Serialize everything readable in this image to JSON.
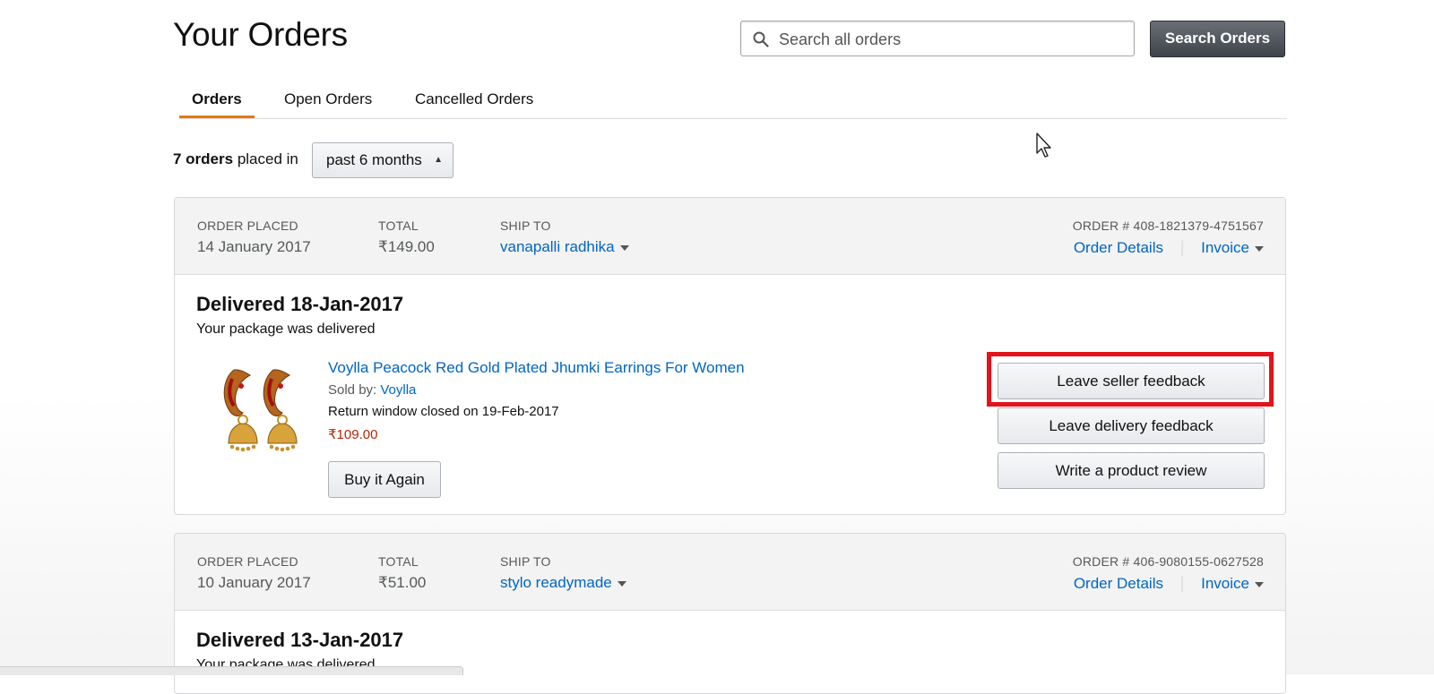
{
  "page": {
    "title": "Your Orders"
  },
  "search": {
    "placeholder": "Search all orders",
    "value": "",
    "button_label": "Search Orders"
  },
  "tabs": [
    {
      "label": "Orders",
      "active": true
    },
    {
      "label": "Open Orders",
      "active": false
    },
    {
      "label": "Cancelled Orders",
      "active": false
    }
  ],
  "filter": {
    "count_bold": "7 orders",
    "count_rest": "placed in",
    "period": "past 6 months"
  },
  "colors": {
    "accent_tab": "#e47911",
    "link": "#0066c0",
    "price": "#b12704",
    "highlight": "#e3131b"
  },
  "orders": [
    {
      "placed_label": "ORDER PLACED",
      "placed_date": "14 January 2017",
      "total_label": "TOTAL",
      "total": "₹149.00",
      "ship_label": "SHIP TO",
      "ship_to": "vanapalli radhika",
      "order_number": "ORDER # 408-1821379-4751567",
      "details_link": "Order Details",
      "invoice_link": "Invoice",
      "status": "Delivered 18-Jan-2017",
      "status_sub": "Your package was delivered",
      "item": {
        "title": "Voylla Peacock Red Gold Plated Jhumki Earrings For Women",
        "sold_by_label": "Sold by:",
        "seller": "Voylla",
        "return_window": "Return window closed on 19-Feb-2017",
        "price": "₹109.00",
        "buy_again": "Buy it Again",
        "image_icon": "jhumki-earrings-image"
      },
      "actions": [
        "Leave seller feedback",
        "Leave delivery feedback",
        "Write a product review"
      ]
    },
    {
      "placed_label": "ORDER PLACED",
      "placed_date": "10 January 2017",
      "total_label": "TOTAL",
      "total": "₹51.00",
      "ship_label": "SHIP TO",
      "ship_to": "stylo readymade",
      "order_number": "ORDER # 406-9080155-0627528",
      "details_link": "Order Details",
      "invoice_link": "Invoice",
      "status": "Delivered 13-Jan-2017",
      "status_sub": "Your package was delivered"
    }
  ]
}
